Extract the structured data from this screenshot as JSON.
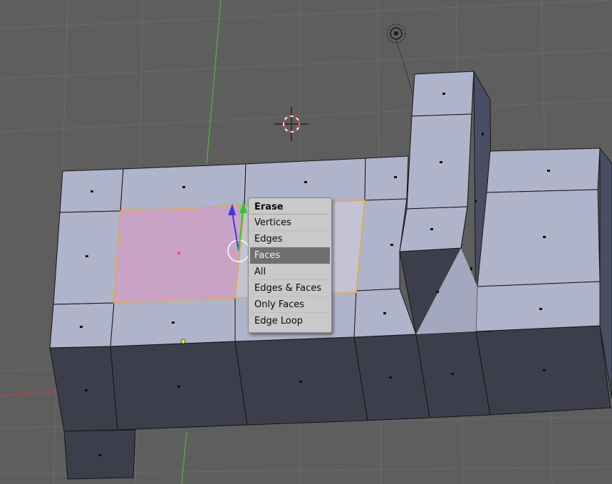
{
  "erase_menu": {
    "title": "Erase",
    "items": [
      {
        "label": "Vertices"
      },
      {
        "label": "Edges"
      },
      {
        "label": "Faces"
      },
      {
        "label": "All"
      },
      {
        "label": "Edges & Faces"
      },
      {
        "label": "Only Faces"
      },
      {
        "label": "Edge Loop"
      }
    ],
    "highlighted_item": "Faces"
  },
  "viewport": {
    "icons": [
      "lamp-icon",
      "3d-cursor-icon",
      "manipulator-icon"
    ],
    "colors": {
      "background": "#5e5e5e",
      "grid_line": "#686868",
      "mesh_top_face": "#b0b4ca",
      "mesh_side_face": "#3c3f4b",
      "selected_face": "#c9a3c6",
      "selection_edge": "#e8a64c",
      "x_axis": "#b04646",
      "y_axis": "#5aa046",
      "z_axis_arrow": "#3a3ae0",
      "y_axis_arrow": "#2ec82e"
    }
  }
}
